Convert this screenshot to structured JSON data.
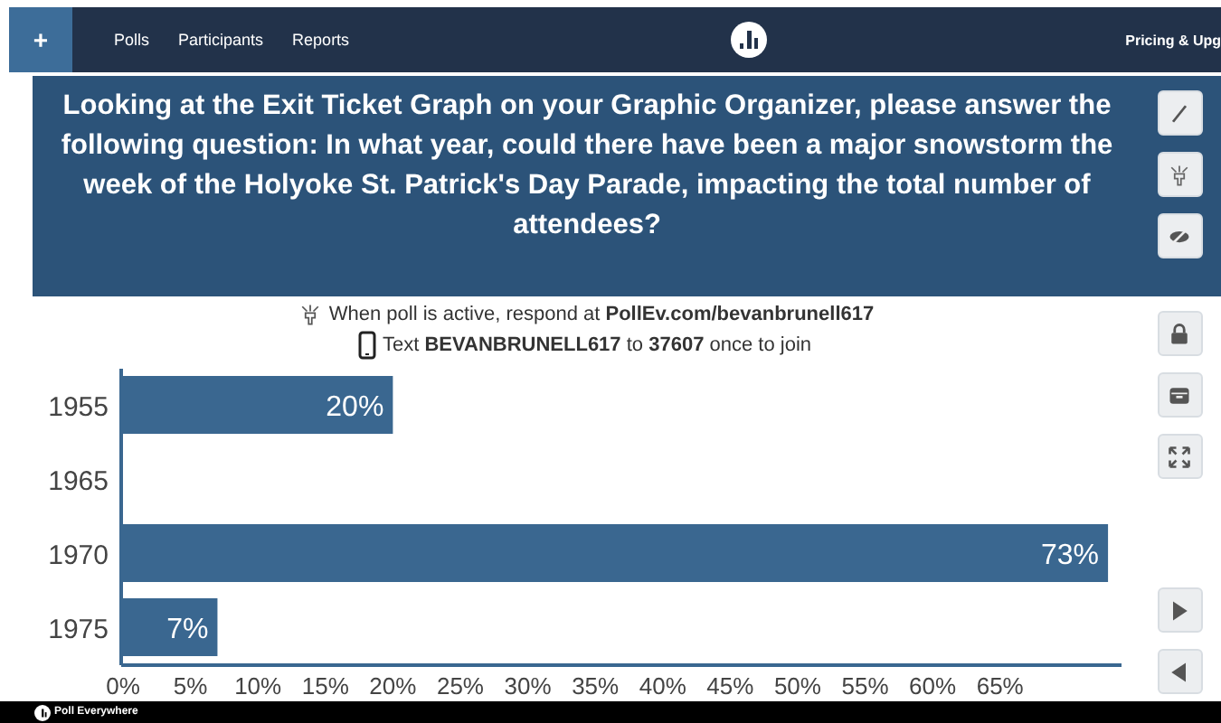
{
  "nav": {
    "items": [
      "Polls",
      "Participants",
      "Reports"
    ],
    "add_button": "+",
    "right_link": "Pricing & Upg"
  },
  "question": "Looking at the Exit Ticket Graph on your Graphic Organizer, please answer the following question: In what year, could there have been a major snowstorm the week of the Holyoke St. Patrick's Day Parade, impacting the total number of attendees?",
  "instructions": [
    "When poll is active, respond at **PollEv.com/bevanbrunell617**",
    "Text **BEVANBRUNELL617** to **37607** once to join"
  ],
  "sidebar_tools": [
    {
      "kind": "pen"
    },
    {
      "kind": "respond"
    },
    {
      "kind": "hide"
    },
    {
      "kind": "lock"
    },
    {
      "kind": "archive"
    },
    {
      "kind": "fullscreen"
    },
    {
      "kind": "next"
    },
    {
      "kind": "previous"
    }
  ],
  "chart_data": {
    "type": "bar",
    "orientation": "horizontal",
    "categories": [
      "1955",
      "1965",
      "1970",
      "1975"
    ],
    "series": [
      {
        "color": "#3a6790",
        "values": [
          20,
          0,
          73,
          7
        ]
      }
    ],
    "xlim": [
      0,
      74
    ],
    "value_labels": [
      "20%",
      null,
      "73%",
      "7%"
    ],
    "xticks": [
      {
        "value": 0,
        "label": "0%"
      },
      {
        "value": 5,
        "label": "5%"
      },
      {
        "value": 10,
        "label": "10%"
      },
      {
        "value": 15,
        "label": "15%"
      },
      {
        "value": 20,
        "label": "20%"
      },
      {
        "value": 25,
        "label": "25%"
      },
      {
        "value": 30,
        "label": "30%"
      },
      {
        "value": 35,
        "label": "35%"
      },
      {
        "value": 40,
        "label": "40%"
      },
      {
        "value": 45,
        "label": "45%"
      },
      {
        "value": 50,
        "label": "50%"
      },
      {
        "value": 55,
        "label": "55%"
      },
      {
        "value": 60,
        "label": "60%"
      },
      {
        "value": 65,
        "label": "65%"
      }
    ]
  },
  "footer": {
    "brand": "Poll Everywhere"
  }
}
